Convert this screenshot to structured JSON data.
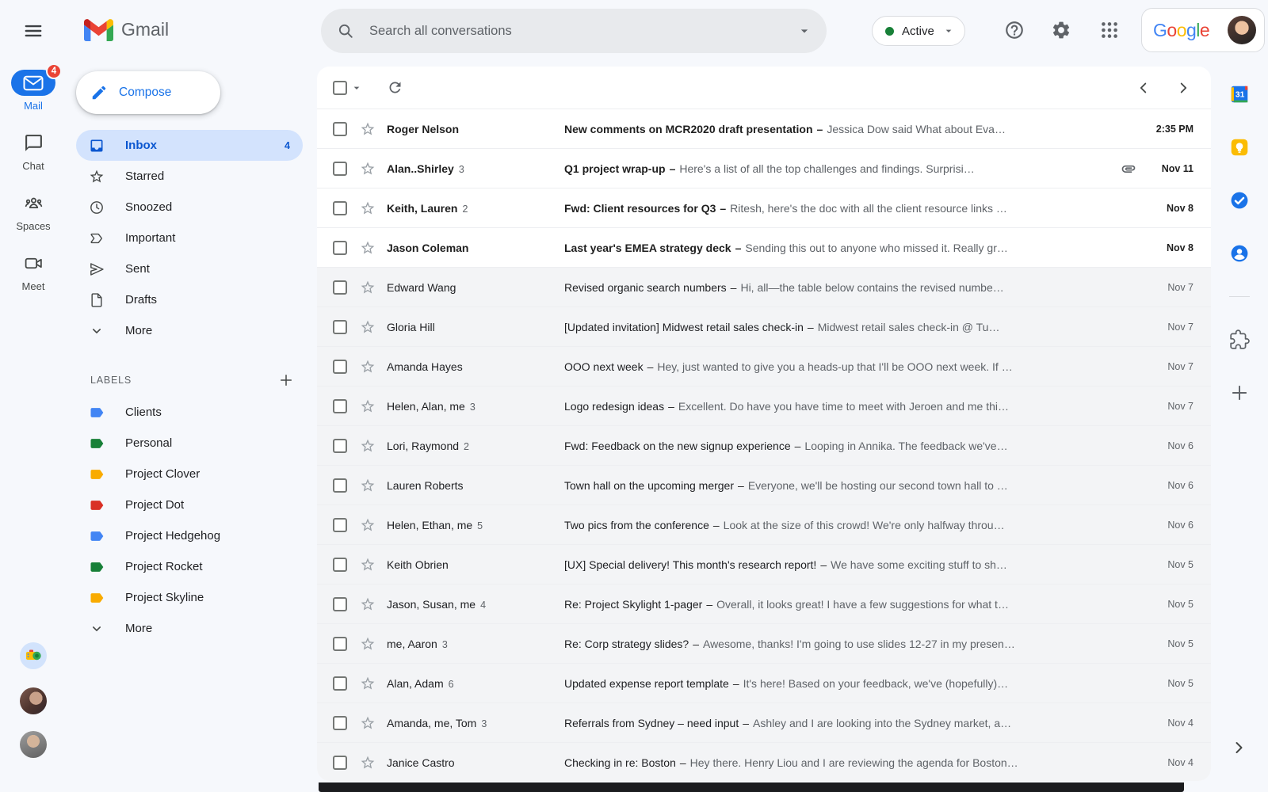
{
  "header": {
    "app_name": "Gmail",
    "search_placeholder": "Search all conversations",
    "status_label": "Active",
    "google_letters": [
      {
        "ch": "G",
        "color": "#4285F4"
      },
      {
        "ch": "o",
        "color": "#EA4335"
      },
      {
        "ch": "o",
        "color": "#FBBC04"
      },
      {
        "ch": "g",
        "color": "#4285F4"
      },
      {
        "ch": "l",
        "color": "#34A853"
      },
      {
        "ch": "e",
        "color": "#EA4335"
      }
    ]
  },
  "rail": {
    "items": [
      {
        "icon": "mail-icon",
        "label": "Mail",
        "badge": "4",
        "active": true
      },
      {
        "icon": "chat-icon",
        "label": "Chat",
        "badge": "",
        "active": false
      },
      {
        "icon": "spaces-icon",
        "label": "Spaces",
        "badge": "",
        "active": false
      },
      {
        "icon": "meet-icon",
        "label": "Meet",
        "badge": "",
        "active": false
      }
    ],
    "avatars": [
      "camera-avatar",
      "woman-avatar",
      "man-avatar"
    ]
  },
  "sidebar": {
    "compose_label": "Compose",
    "items": [
      {
        "icon": "inbox-icon",
        "label": "Inbox",
        "count": "4",
        "active": true
      },
      {
        "icon": "star-icon",
        "label": "Starred",
        "count": "",
        "active": false
      },
      {
        "icon": "snooze-icon",
        "label": "Snoozed",
        "count": "",
        "active": false
      },
      {
        "icon": "important-icon",
        "label": "Important",
        "count": "",
        "active": false
      },
      {
        "icon": "sent-icon",
        "label": "Sent",
        "count": "",
        "active": false
      },
      {
        "icon": "drafts-icon",
        "label": "Drafts",
        "count": "",
        "active": false
      },
      {
        "icon": "chevron-down-icon",
        "label": "More",
        "count": "",
        "active": false
      }
    ],
    "labels_header": "LABELS",
    "labels": [
      {
        "name": "Clients",
        "color": "#4285f4"
      },
      {
        "name": "Personal",
        "color": "#188038"
      },
      {
        "name": "Project Clover",
        "color": "#f9ab00"
      },
      {
        "name": "Project Dot",
        "color": "#d93025"
      },
      {
        "name": "Project Hedgehog",
        "color": "#4285f4"
      },
      {
        "name": "Project Rocket",
        "color": "#188038"
      },
      {
        "name": "Project Skyline",
        "color": "#f9ab00"
      }
    ],
    "labels_more_label": "More"
  },
  "list": {
    "separator": "–",
    "emails": [
      {
        "sender": "Roger Nelson",
        "count": "",
        "subject": "New comments on MCR2020 draft presentation",
        "snippet": "Jessica Dow said What about Eva…",
        "date": "2:35 PM",
        "unread": true,
        "has_attachment": false
      },
      {
        "sender": "Alan..Shirley",
        "count": "3",
        "subject": "Q1 project wrap-up",
        "snippet": "Here's a list of all the top challenges and findings. Surprisi…",
        "date": "Nov 11",
        "unread": true,
        "has_attachment": true
      },
      {
        "sender": "Keith, Lauren",
        "count": "2",
        "subject": "Fwd: Client resources for Q3",
        "snippet": "Ritesh, here's the doc with all the client resource links …",
        "date": "Nov 8",
        "unread": true,
        "has_attachment": false
      },
      {
        "sender": "Jason Coleman",
        "count": "",
        "subject": "Last year's EMEA strategy deck",
        "snippet": "Sending this out to anyone who missed it. Really gr…",
        "date": "Nov 8",
        "unread": true,
        "has_attachment": false
      },
      {
        "sender": "Edward Wang",
        "count": "",
        "subject": "Revised organic search numbers",
        "snippet": "Hi, all—the table below contains the revised numbe…",
        "date": "Nov 7",
        "unread": false,
        "has_attachment": false
      },
      {
        "sender": "Gloria Hill",
        "count": "",
        "subject": "[Updated invitation] Midwest retail sales check-in",
        "snippet": "Midwest retail sales check-in @ Tu…",
        "date": "Nov 7",
        "unread": false,
        "has_attachment": false
      },
      {
        "sender": "Amanda Hayes",
        "count": "",
        "subject": "OOO next week",
        "snippet": "Hey, just wanted to give you a heads-up that I'll be OOO next week. If …",
        "date": "Nov 7",
        "unread": false,
        "has_attachment": false
      },
      {
        "sender": "Helen, Alan, me",
        "count": "3",
        "subject": "Logo redesign ideas",
        "snippet": "Excellent. Do have you have time to meet with Jeroen and me thi…",
        "date": "Nov 7",
        "unread": false,
        "has_attachment": false
      },
      {
        "sender": "Lori, Raymond",
        "count": "2",
        "subject": "Fwd: Feedback on the new signup experience",
        "snippet": "Looping in Annika. The feedback we've…",
        "date": "Nov 6",
        "unread": false,
        "has_attachment": false
      },
      {
        "sender": "Lauren Roberts",
        "count": "",
        "subject": "Town hall on the upcoming merger",
        "snippet": "Everyone, we'll be hosting our second town hall to …",
        "date": "Nov 6",
        "unread": false,
        "has_attachment": false
      },
      {
        "sender": "Helen, Ethan, me",
        "count": "5",
        "subject": "Two pics from the conference",
        "snippet": "Look at the size of this crowd! We're only halfway throu…",
        "date": "Nov 6",
        "unread": false,
        "has_attachment": false
      },
      {
        "sender": "Keith Obrien",
        "count": "",
        "subject": "[UX] Special delivery! This month's research report!",
        "snippet": "We have some exciting stuff to sh…",
        "date": "Nov 5",
        "unread": false,
        "has_attachment": false
      },
      {
        "sender": "Jason, Susan, me",
        "count": "4",
        "subject": "Re: Project Skylight 1-pager",
        "snippet": "Overall, it looks great! I have a few suggestions for what t…",
        "date": "Nov 5",
        "unread": false,
        "has_attachment": false
      },
      {
        "sender": "me, Aaron",
        "count": "3",
        "subject": "Re: Corp strategy slides?",
        "snippet": "Awesome, thanks! I'm going to use slides 12-27 in my presen…",
        "date": "Nov 5",
        "unread": false,
        "has_attachment": false
      },
      {
        "sender": "Alan, Adam",
        "count": "6",
        "subject": "Updated expense report template",
        "snippet": "It's here! Based on your feedback, we've (hopefully)…",
        "date": "Nov 5",
        "unread": false,
        "has_attachment": false
      },
      {
        "sender": "Amanda, me, Tom",
        "count": "3",
        "subject": "Referrals from Sydney – need input",
        "snippet": "Ashley and I are looking into the Sydney market, a…",
        "date": "Nov 4",
        "unread": false,
        "has_attachment": false
      },
      {
        "sender": "Janice Castro",
        "count": "",
        "subject": "Checking in re: Boston",
        "snippet": "Hey there. Henry Liou and I are reviewing the agenda for Boston…",
        "date": "Nov 4",
        "unread": false,
        "has_attachment": false
      }
    ]
  },
  "side_panel": {
    "items": [
      "calendar-icon",
      "keep-icon",
      "tasks-icon",
      "contacts-icon",
      "divider",
      "extension-icon",
      "plus-icon"
    ],
    "collapse_icon": "chevron-right-icon"
  },
  "colors": {
    "page_bg": "#f6f8fc",
    "accent_blue": "#1a73e8",
    "selected_pill_bg": "#d3e3fd",
    "selected_text": "#0b57d0",
    "badge_red": "#ea4335",
    "active_status_green": "#188038",
    "secondary_text": "#5f6368",
    "unread_text": "#1f1f1f",
    "read_row_bg": "#f3f4f6",
    "search_bg": "#e8eaed"
  }
}
